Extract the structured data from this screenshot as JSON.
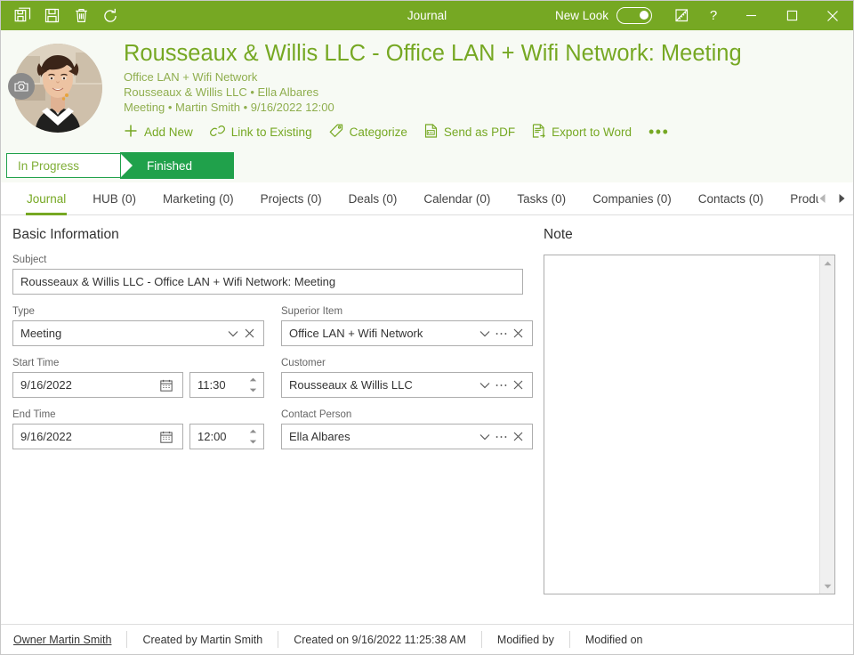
{
  "titlebar": {
    "title": "Journal",
    "new_look_label": "New Look",
    "toggle_state": "on",
    "help_label": "?",
    "buttons": [
      {
        "name": "save-as",
        "icon": "save-as-icon"
      },
      {
        "name": "save",
        "icon": "save-icon"
      },
      {
        "name": "delete",
        "icon": "trash-icon"
      },
      {
        "name": "refresh",
        "icon": "refresh-icon"
      }
    ],
    "window_controls": [
      "minimize",
      "maximize",
      "close"
    ],
    "accent_color": "#76a823"
  },
  "header": {
    "doc_title": "Rousseaux & Willis LLC - Office LAN + Wifi Network: Meeting",
    "sub_line_1": "Office LAN + Wifi Network",
    "sub_line_2": "Rousseaux & Willis LLC • Ella Albares",
    "sub_line_3": "Meeting • Martin Smith • 9/16/2022 12:00",
    "avatar_alt": "contact-photo",
    "actions": [
      {
        "label": "Add New",
        "icon": "plus-icon"
      },
      {
        "label": "Link to Existing",
        "icon": "link-icon"
      },
      {
        "label": "Categorize",
        "icon": "tag-icon"
      },
      {
        "label": "Send as PDF",
        "icon": "pdf-icon"
      },
      {
        "label": "Export to Word",
        "icon": "word-icon"
      }
    ],
    "more_label": "•••",
    "title_color": "#76a823",
    "subtitle_color": "#8fae4e"
  },
  "stages": {
    "items": [
      {
        "label": "In Progress",
        "state": "inactive"
      },
      {
        "label": "Finished",
        "state": "active"
      }
    ],
    "active_color": "#20A14B"
  },
  "tabs": {
    "items": [
      {
        "label": "Journal",
        "active": true
      },
      {
        "label": "HUB (0)",
        "active": false
      },
      {
        "label": "Marketing (0)",
        "active": false
      },
      {
        "label": "Projects (0)",
        "active": false
      },
      {
        "label": "Deals (0)",
        "active": false
      },
      {
        "label": "Calendar (0)",
        "active": false
      },
      {
        "label": "Tasks (0)",
        "active": false
      },
      {
        "label": "Companies (0)",
        "active": false
      },
      {
        "label": "Contacts (0)",
        "active": false
      },
      {
        "label": "Products (",
        "active": false
      }
    ],
    "scroll_left": "left-arrow-icon",
    "scroll_right": "right-arrow-icon"
  },
  "main": {
    "basic_information_title": "Basic Information",
    "note_title": "Note",
    "note_value": "",
    "fields": {
      "subject": {
        "label": "Subject",
        "value": "Rousseaux & Willis LLC - Office LAN + Wifi Network: Meeting"
      },
      "type": {
        "label": "Type",
        "value": "Meeting"
      },
      "superior_item": {
        "label": "Superior Item",
        "value": "Office LAN + Wifi Network"
      },
      "start_time": {
        "label": "Start Time",
        "date": "9/16/2022",
        "time": "11:30"
      },
      "customer": {
        "label": "Customer",
        "value": "Rousseaux & Willis LLC"
      },
      "end_time": {
        "label": "End Time",
        "date": "9/16/2022",
        "time": "12:00"
      },
      "contact_person": {
        "label": "Contact Person",
        "value": "Ella Albares"
      }
    }
  },
  "statusbar": {
    "owner": "Owner Martin Smith",
    "created_by": "Created by Martin Smith",
    "created_on": "Created on 9/16/2022 11:25:38 AM",
    "modified_by": "Modified by",
    "modified_on": "Modified on"
  }
}
